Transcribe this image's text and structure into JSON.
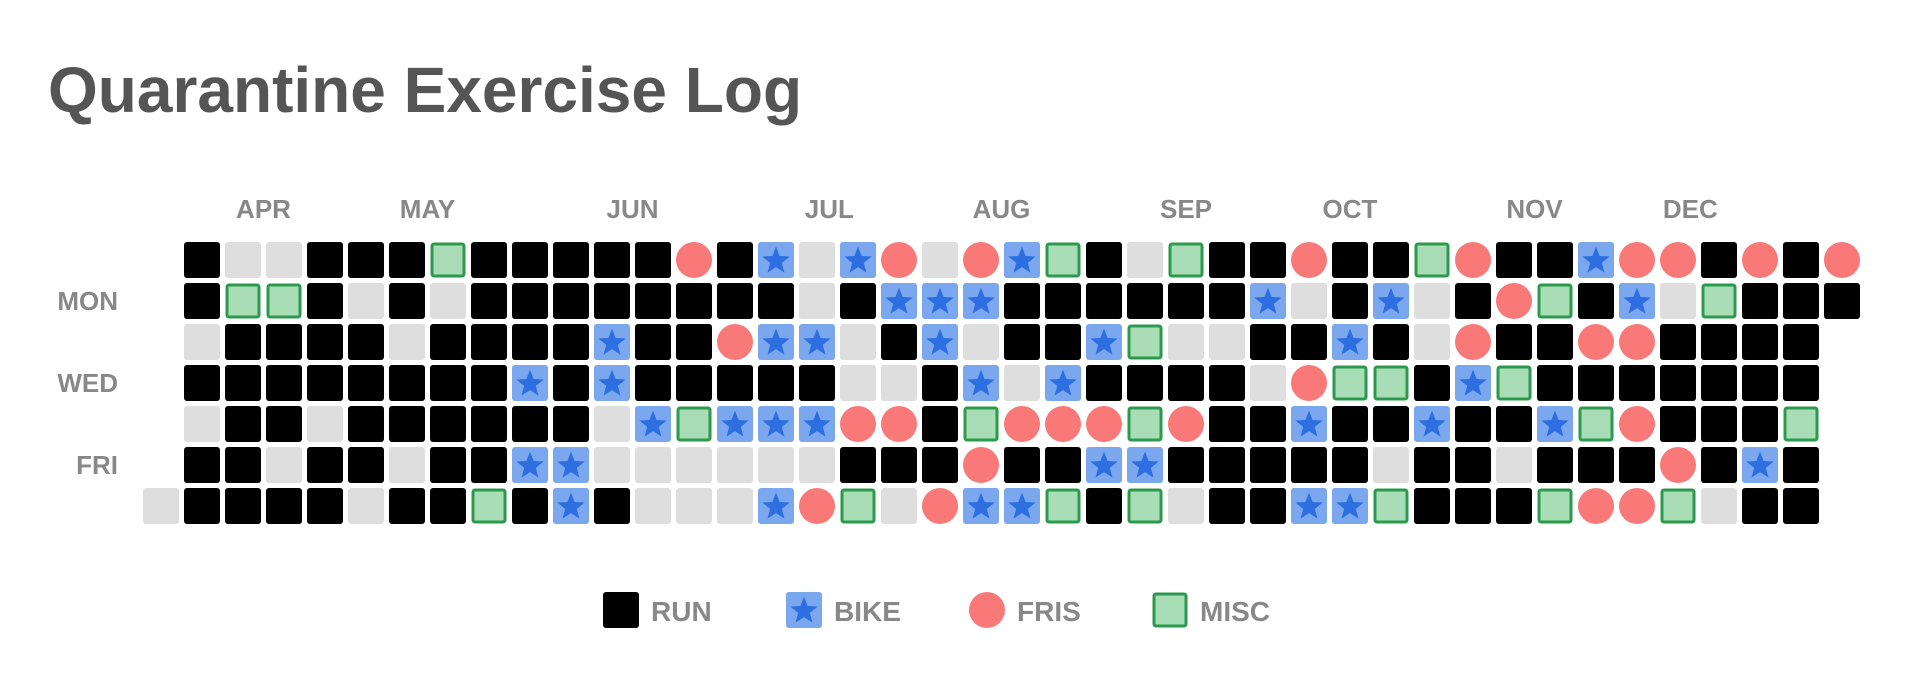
{
  "chart_data": {
    "type": "heatmap",
    "title": "Quarantine Exercise Log",
    "day_labels": [
      {
        "label": "MON",
        "row": 1
      },
      {
        "label": "WED",
        "row": 3
      },
      {
        "label": "FRI",
        "row": 5
      }
    ],
    "month_labels": [
      {
        "label": "APR",
        "week": 2.5
      },
      {
        "label": "MAY",
        "week": 6.5
      },
      {
        "label": "JUN",
        "week": 11.5
      },
      {
        "label": "JUL",
        "week": 16.3
      },
      {
        "label": "AUG",
        "week": 20.5
      },
      {
        "label": "SEP",
        "week": 25
      },
      {
        "label": "OCT",
        "week": 29
      },
      {
        "label": "NOV",
        "week": 33.5
      },
      {
        "label": "DEC",
        "week": 37.3
      }
    ],
    "categories": {
      "R": {
        "label": "RUN",
        "fill": "#000000",
        "shape": "square"
      },
      "B": {
        "label": "BIKE",
        "fill": "#7aa7ee",
        "star": "#2d6fe0",
        "shape": "star"
      },
      "F": {
        "label": "FRIS",
        "fill": "#f97878",
        "shape": "circle"
      },
      "M": {
        "label": "MISC",
        "fill": "#a8ddb6",
        "stroke": "#2b9a4e",
        "shape": "outlined-square"
      },
      "E": {
        "label": "",
        "fill": "#dedede",
        "shape": "square"
      }
    },
    "legend": [
      {
        "key": "R",
        "label": "RUN"
      },
      {
        "key": "B",
        "label": "BIKE"
      },
      {
        "key": "F",
        "label": "FRIS"
      },
      {
        "key": "M",
        "label": "MISC"
      }
    ],
    "grid": {
      "first_week_start_row": 6,
      "weeks": [
        [
          "E"
        ],
        [
          "R",
          "R",
          "E",
          "R",
          "E",
          "R",
          "R"
        ],
        [
          "E",
          "M",
          "R",
          "R",
          "R",
          "R",
          "R"
        ],
        [
          "E",
          "M",
          "R",
          "R",
          "R",
          "E",
          "R"
        ],
        [
          "R",
          "R",
          "R",
          "R",
          "E",
          "R",
          "R"
        ],
        [
          "R",
          "E",
          "R",
          "R",
          "R",
          "R",
          "E"
        ],
        [
          "R",
          "R",
          "E",
          "R",
          "R",
          "E",
          "R"
        ],
        [
          "M",
          "E",
          "R",
          "R",
          "R",
          "R",
          "R"
        ],
        [
          "R",
          "R",
          "R",
          "R",
          "R",
          "R",
          "M"
        ],
        [
          "R",
          "R",
          "R",
          "B",
          "R",
          "B",
          "R"
        ],
        [
          "R",
          "R",
          "R",
          "R",
          "R",
          "B",
          "B"
        ],
        [
          "R",
          "R",
          "B",
          "B",
          "E",
          "E",
          "R"
        ],
        [
          "R",
          "R",
          "R",
          "R",
          "B",
          "E",
          "E"
        ],
        [
          "F",
          "R",
          "R",
          "R",
          "M",
          "E",
          "E"
        ],
        [
          "R",
          "R",
          "F",
          "R",
          "B",
          "E",
          "E"
        ],
        [
          "B",
          "R",
          "B",
          "R",
          "B",
          "E",
          "B"
        ],
        [
          "E",
          "E",
          "B",
          "R",
          "B",
          "E",
          "F"
        ],
        [
          "B",
          "R",
          "E",
          "E",
          "F",
          "R",
          "M"
        ],
        [
          "F",
          "B",
          "R",
          "E",
          "F",
          "R",
          "E"
        ],
        [
          "E",
          "B",
          "B",
          "R",
          "R",
          "R",
          "F"
        ],
        [
          "F",
          "B",
          "E",
          "B",
          "M",
          "F",
          "B"
        ],
        [
          "B",
          "R",
          "R",
          "E",
          "F",
          "R",
          "B"
        ],
        [
          "M",
          "R",
          "R",
          "B",
          "F",
          "R",
          "M"
        ],
        [
          "R",
          "R",
          "B",
          "R",
          "F",
          "B",
          "R"
        ],
        [
          "E",
          "R",
          "M",
          "R",
          "M",
          "B",
          "M"
        ],
        [
          "M",
          "R",
          "E",
          "R",
          "F",
          "R",
          "E"
        ],
        [
          "R",
          "R",
          "E",
          "R",
          "R",
          "R",
          "R"
        ],
        [
          "R",
          "B",
          "R",
          "E",
          "R",
          "R",
          "R"
        ],
        [
          "F",
          "E",
          "R",
          "F",
          "B",
          "R",
          "B"
        ],
        [
          "R",
          "R",
          "B",
          "M",
          "R",
          "R",
          "B"
        ],
        [
          "R",
          "B",
          "R",
          "M",
          "R",
          "E",
          "M"
        ],
        [
          "M",
          "E",
          "E",
          "R",
          "B",
          "R",
          "R"
        ],
        [
          "F",
          "R",
          "F",
          "B",
          "R",
          "R",
          "R"
        ],
        [
          "R",
          "F",
          "R",
          "M",
          "R",
          "E",
          "R"
        ],
        [
          "R",
          "M",
          "R",
          "R",
          "B",
          "R",
          "M"
        ],
        [
          "B",
          "R",
          "F",
          "R",
          "M",
          "R",
          "F"
        ],
        [
          "F",
          "B",
          "F",
          "R",
          "F",
          "R",
          "F"
        ],
        [
          "F",
          "E",
          "R",
          "R",
          "R",
          "F",
          "M"
        ],
        [
          "R",
          "M",
          "R",
          "R",
          "R",
          "R",
          "E"
        ],
        [
          "F",
          "R",
          "R",
          "R",
          "R",
          "B",
          "R"
        ],
        [
          "R",
          "R",
          "R",
          "R",
          "M",
          "R",
          "R"
        ],
        [
          "F",
          "R"
        ]
      ]
    }
  }
}
